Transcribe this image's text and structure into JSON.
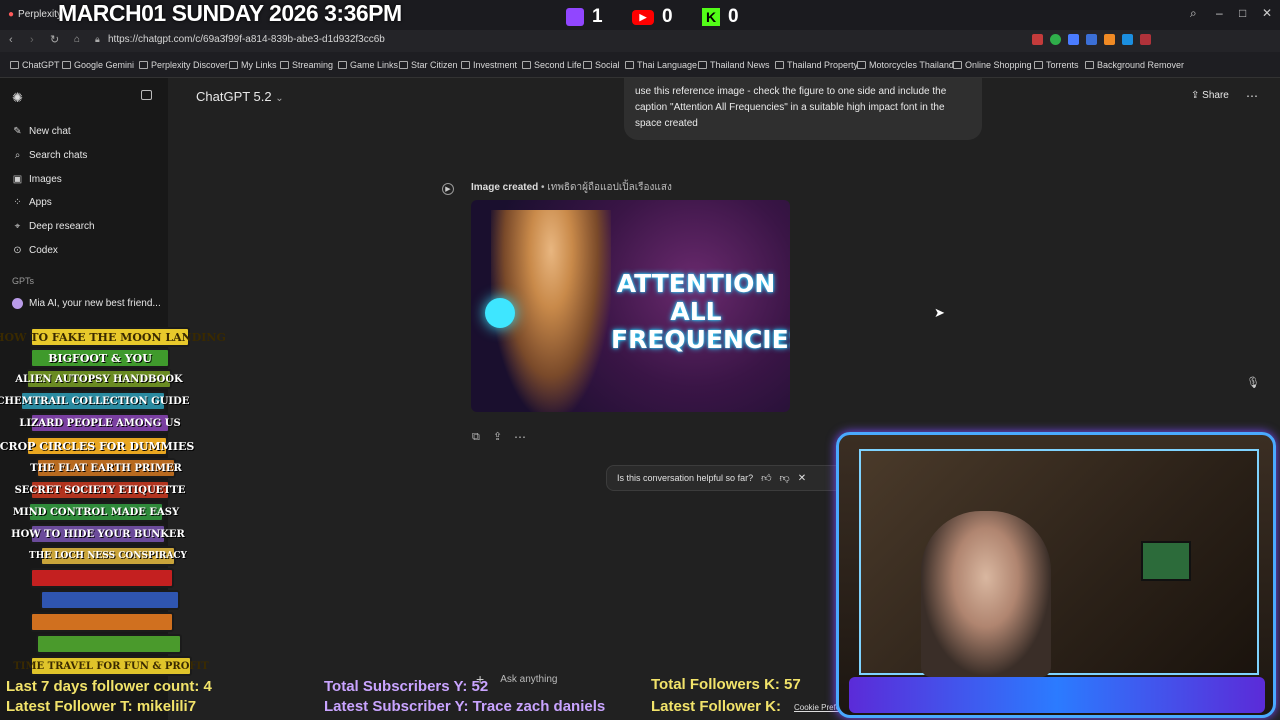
{
  "overlay": {
    "date_time": "MARCH01 SUNDAY 2026 3:36PM",
    "twitch_count": "1",
    "youtube_count": "0",
    "kick_count": "0",
    "last7_followers": "Last 7 days follower count: 4",
    "latest_follower_t": "Latest Follower T: mikelili7",
    "total_subscribers_y": "Total Subscribers Y: 52",
    "latest_subscriber_y": "Latest Subscriber Y: Trace zach daniels",
    "total_followers_k": "Total Followers K: 57",
    "latest_follower_k": "Latest Follower K:",
    "books": [
      "HOW TO FAKE THE MOON LANDING",
      "BIGFOOT & YOU",
      "ALIEN AUTOPSY HANDBOOK",
      "CHEMTRAIL COLLECTION GUIDE",
      "LIZARD PEOPLE AMONG US",
      "CROP CIRCLES FOR DUMMIES",
      "THE FLAT EARTH PRIMER",
      "SECRET SOCIETY ETIQUETTE",
      "MIND CONTROL MADE EASY",
      "HOW TO HIDE YOUR BUNKER",
      "THE LOCH NESS CONSPIRACY",
      "",
      "",
      "",
      "",
      "TIME TRAVEL FOR FUN & PROFIT"
    ]
  },
  "browser": {
    "tab_label": "Perplexity",
    "url": "https://chatgpt.com/c/69a3f99f-a814-839b-abe3-d1d932f3cc6b",
    "bookmarks": [
      "ChatGPT",
      "Google Gemini",
      "Perplexity Discover",
      "My Links",
      "Streaming",
      "Game Links",
      "Star Citizen",
      "Investment",
      "Second Life",
      "Social",
      "Thai Language",
      "Thailand News",
      "Thailand Property",
      "Motorcycles Thailand",
      "Online Shopping",
      "Torrents",
      "Background Remover"
    ]
  },
  "sidebar": {
    "items": [
      {
        "label": "New chat",
        "icon": "edit-icon"
      },
      {
        "label": "Search chats",
        "icon": "search-icon"
      },
      {
        "label": "Images",
        "icon": "image-icon"
      },
      {
        "label": "Apps",
        "icon": "grid-icon"
      },
      {
        "label": "Deep research",
        "icon": "telescope-icon"
      },
      {
        "label": "Codex",
        "icon": "code-icon"
      }
    ],
    "gpts_heading": "GPTs",
    "gpt_item": "Mia AI, your new best friend..."
  },
  "main": {
    "model_label": "ChatGPT 5.2",
    "share_label": "Share",
    "user_message": "use this reference image - check the figure to one side and include the caption \"Attention All Frequencies\" in a suitable high impact font in the space created",
    "image_created_label": "Image created",
    "image_created_sub": "• เทพธิดาผู้ถือแอปเปิ้ลเรืองแสง",
    "image_caption": "ATTENTION ALL FREQUENCIES",
    "feedback_question": "Is this conversation helpful so far?",
    "composer_placeholder": "Ask anything",
    "cookie_link": "Cookie Preferences."
  },
  "colors": {
    "accent": "#2ad3ff",
    "bg": "#212121",
    "sidebar": "#181818",
    "overlay_yellow": "#f2e36a",
    "overlay_purple": "#c9a4ff"
  }
}
